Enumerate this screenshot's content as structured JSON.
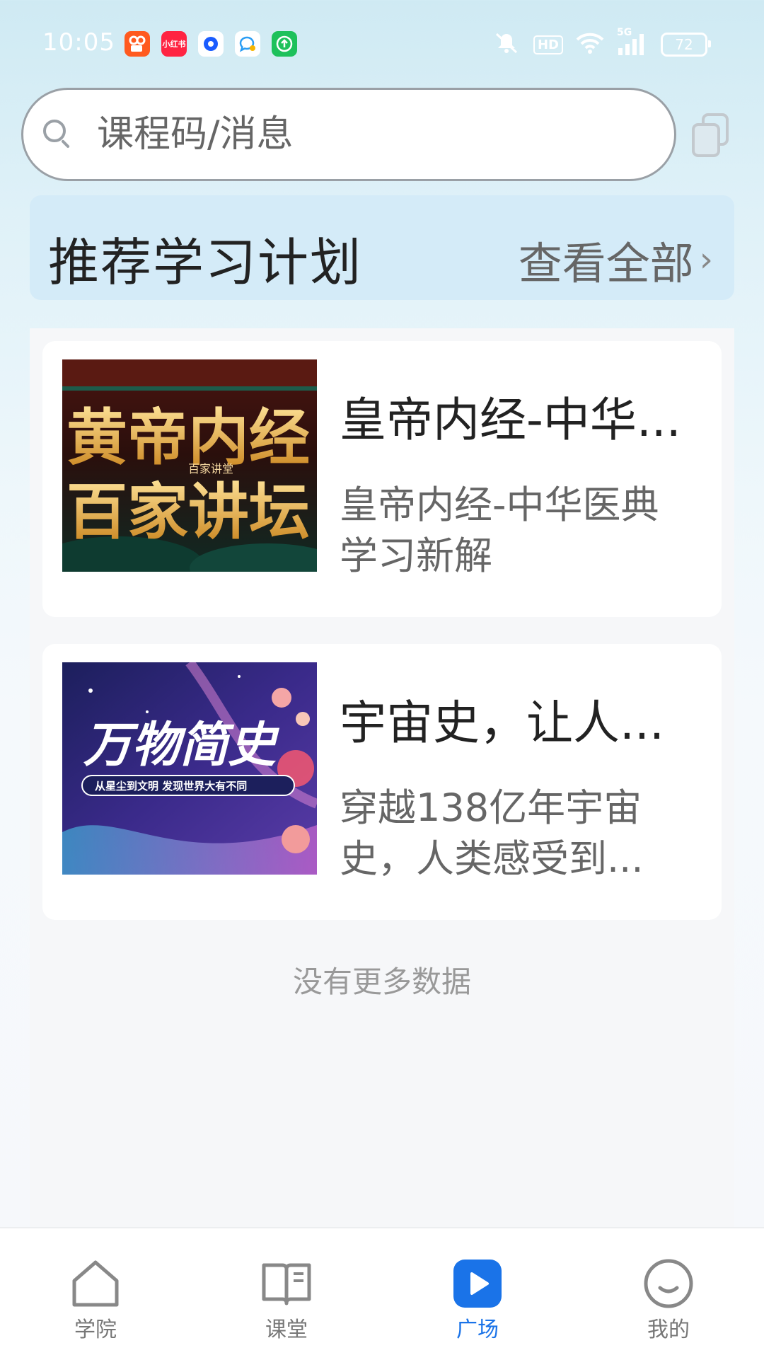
{
  "status_bar": {
    "time": "10:05",
    "apps": [
      {
        "name": "kuaishou-icon",
        "color": "#ff5a1f",
        "label": ""
      },
      {
        "name": "xiaohongshu-icon",
        "color": "#ff2442",
        "label": "小红书"
      },
      {
        "name": "app-blue-icon",
        "color": "#ffffff",
        "label": ""
      },
      {
        "name": "message-icon",
        "color": "#ffffff",
        "label": ""
      },
      {
        "name": "upload-icon",
        "color": "#1ec15b",
        "label": ""
      }
    ],
    "hd": "HD",
    "network": "5G",
    "battery": "72"
  },
  "search": {
    "placeholder": "课程码/消息"
  },
  "plan": {
    "title": "推荐学习计划",
    "view_all": "查看全部",
    "chevron": "›"
  },
  "cards": [
    {
      "title": "皇帝内经-中华...",
      "desc": "皇帝内经-中华医典学习新解",
      "thumb_title_1": "黄帝内经",
      "thumb_title_2": "百家讲坛",
      "thumb_sub": "百家讲堂"
    },
    {
      "title": "宇宙史，让人...",
      "desc": "穿越138亿年宇宙史，人类感受到...",
      "thumb_title": "万物简史",
      "thumb_sub": "从星尘到文明 发现世界大有不同"
    }
  ],
  "no_more": "没有更多数据",
  "tabs": [
    {
      "label": "学院",
      "icon": "home-icon",
      "active": false
    },
    {
      "label": "课堂",
      "icon": "book-icon",
      "active": false
    },
    {
      "label": "广场",
      "icon": "play-icon",
      "active": true
    },
    {
      "label": "我的",
      "icon": "smile-icon",
      "active": false
    }
  ],
  "colors": {
    "accent": "#1a73e8",
    "plan_bg": "#d4ebf8"
  }
}
